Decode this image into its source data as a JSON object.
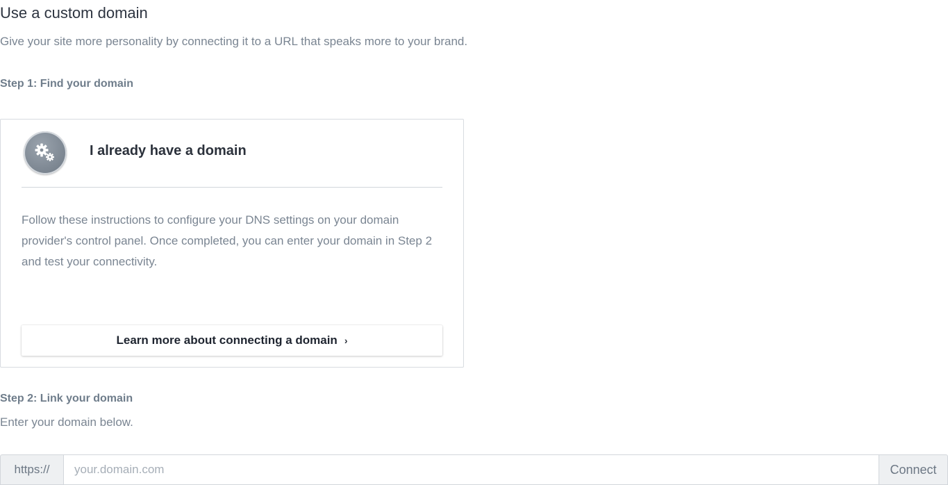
{
  "header": {
    "title": "Use a custom domain",
    "subtitle": "Give your site more personality by connecting it to a URL that speaks more to your brand."
  },
  "step1": {
    "heading": "Step 1: Find your domain",
    "card": {
      "icon": "gears-icon",
      "title": "I already have a domain",
      "body": "Follow these instructions to configure your DNS settings on your domain provider's control panel. Once completed, you can enter your domain in Step 2 and test your connectivity.",
      "button_label": "Learn more about connecting a domain",
      "button_icon": "chevron-right-icon",
      "button_chevron": "›"
    }
  },
  "step2": {
    "heading": "Step 2: Link your domain",
    "description": "Enter your domain below.",
    "input": {
      "prefix": "https://",
      "placeholder": "your.domain.com",
      "value": ""
    },
    "connect_label": "Connect"
  },
  "colors": {
    "heading_text": "#2d3440",
    "muted_text": "#7a8592",
    "step_heading": "#6f7d8b",
    "border": "#d2d6db",
    "addon_bg": "#eef0f2"
  }
}
